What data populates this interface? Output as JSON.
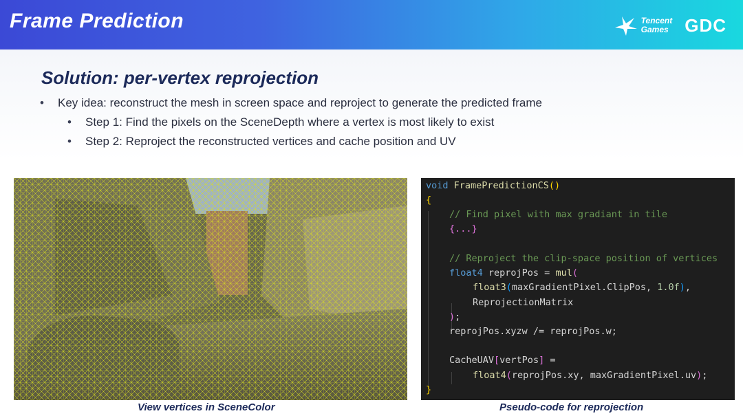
{
  "header": {
    "title": "Frame Prediction",
    "logo_tencent_line1": "Tencent",
    "logo_tencent_line2": "Games",
    "logo_gdc": "GDC"
  },
  "subtitle": "Solution: per-vertex reprojection",
  "bullets": {
    "main": "Key idea: reconstruct the mesh in screen space and reproject to generate the predicted frame",
    "step1": "Step 1: Find the pixels on the SceneDepth where a vertex is most likely to exist",
    "step2": "Step 2: Reproject the reconstructed vertices and cache position and UV"
  },
  "captions": {
    "left": "View vertices in SceneColor",
    "right": "Pseudo-code for reprojection"
  },
  "code": {
    "l1_kw": "void",
    "l1_fn": "FramePredictionCS",
    "l1_paren": "()",
    "l2": "{",
    "l3": "// Find pixel with max gradiant in tile",
    "l4": "{...}",
    "l5": "// Reproject the clip-space position of vertices",
    "l6_kw": "float4",
    "l6_mid": " reprojPos = ",
    "l6_fn": "mul",
    "l6_paren": "(",
    "l7_fn": "float3",
    "l7_open": "(",
    "l7_mid": "maxGradientPixel.ClipPos, ",
    "l7_num": "1.0f",
    "l7_close": ")",
    "l7_end": ",",
    "l8": "ReprojectionMatrix",
    "l9_paren": ")",
    "l9_end": ";",
    "l10": "reprojPos.xyzw /= reprojPos.w;",
    "l11_start": "CacheUAV",
    "l11_open": "[",
    "l11_mid": "vertPos",
    "l11_close": "]",
    "l11_end": " =",
    "l12_fn": "float4",
    "l12_open": "(",
    "l12_mid": "reprojPos.xy, maxGradientPixel.uv",
    "l12_close": ")",
    "l12_end": ";",
    "l13": "}"
  },
  "colors": {
    "code_keyword": "#569cd6",
    "code_function": "#dcdcaa",
    "code_comment": "#6a9955",
    "code_number": "#b5cea8",
    "mesh_wireframe": "#d8e020"
  }
}
